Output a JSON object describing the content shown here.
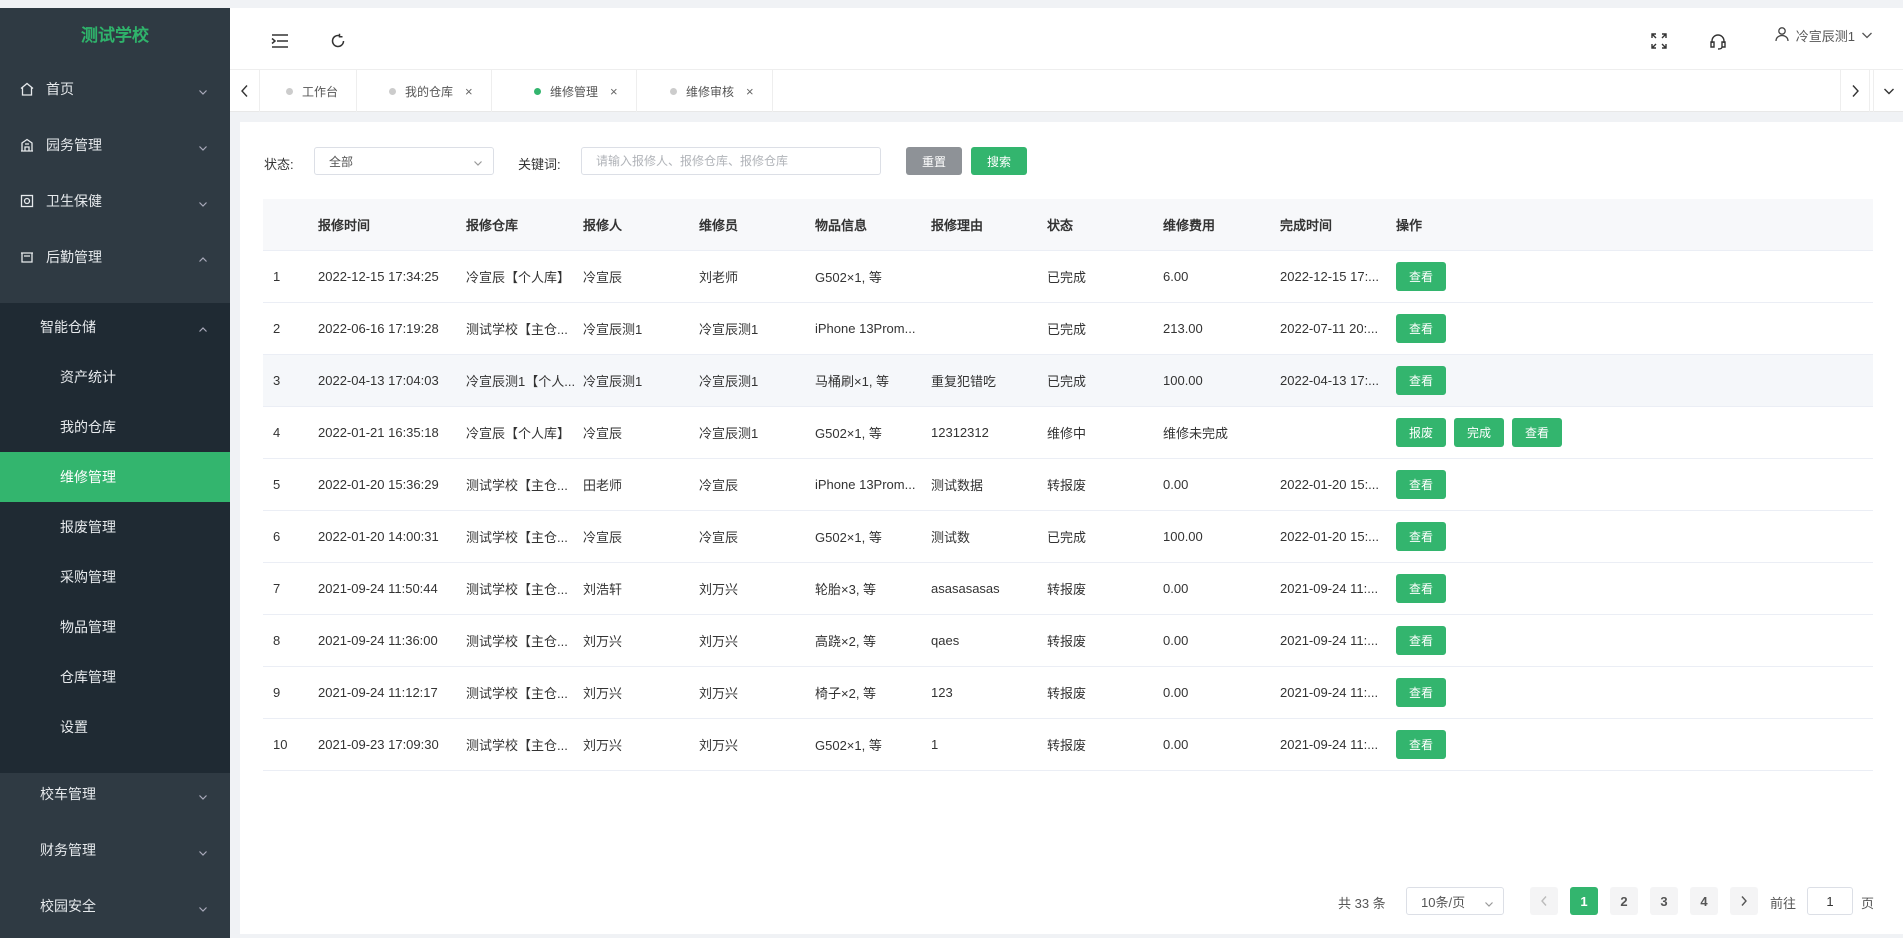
{
  "sidebar": {
    "logo": "测试学校",
    "top_items": [
      {
        "label": "首页",
        "icon": "home-icon"
      },
      {
        "label": "园务管理",
        "icon": "building-icon"
      },
      {
        "label": "卫生保健",
        "icon": "health-icon"
      },
      {
        "label": "后勤管理",
        "icon": "logistics-icon"
      }
    ],
    "group_label": "智能仓储",
    "sub_items": [
      "资产统计",
      "我的仓库",
      "维修管理",
      "报废管理",
      "采购管理",
      "物品管理",
      "仓库管理",
      "设置"
    ],
    "active_sub": "维修管理",
    "bottom_groups": [
      "校车管理",
      "财务管理",
      "校园安全"
    ]
  },
  "header": {
    "user_name": "冷宣辰测1"
  },
  "tabs": [
    {
      "label": "工作台",
      "closable": false
    },
    {
      "label": "我的仓库",
      "closable": true
    },
    {
      "label": "维修管理",
      "closable": true,
      "active": true
    },
    {
      "label": "维修审核",
      "closable": true
    }
  ],
  "filter": {
    "status_label": "状态:",
    "status_value": "全部",
    "keyword_label": "关键词:",
    "keyword_placeholder": "请输入报修人、报修仓库、报修仓库",
    "reset_label": "重置",
    "search_label": "搜索"
  },
  "table": {
    "columns": [
      "",
      "报修时间",
      "报修仓库",
      "报修人",
      "维修员",
      "物品信息",
      "报修理由",
      "状态",
      "维修费用",
      "完成时间",
      "操作"
    ],
    "rows": [
      [
        "1",
        "2022-12-15 17:34:25",
        "冷宣辰【个人库】",
        "冷宣辰",
        "刘老师",
        "G502×1, 等",
        "",
        "已完成",
        "6.00",
        "2022-12-15 17:...",
        [
          "查看"
        ]
      ],
      [
        "2",
        "2022-06-16 17:19:28",
        "测试学校【主仓...",
        "冷宣辰测1",
        "冷宣辰测1",
        "iPhone 13Prom...",
        "",
        "已完成",
        "213.00",
        "2022-07-11 20:...",
        [
          "查看"
        ]
      ],
      [
        "3",
        "2022-04-13 17:04:03",
        "冷宣辰测1【个人...",
        "冷宣辰测1",
        "冷宣辰测1",
        "马桶刷×1, 等",
        "重复犯错吃",
        "已完成",
        "100.00",
        "2022-04-13 17:...",
        [
          "查看"
        ]
      ],
      [
        "4",
        "2022-01-21 16:35:18",
        "冷宣辰【个人库】",
        "冷宣辰",
        "冷宣辰测1",
        "G502×1, 等",
        "12312312",
        "维修中",
        "维修未完成",
        "",
        [
          "报废",
          "完成",
          "查看"
        ]
      ],
      [
        "5",
        "2022-01-20 15:36:29",
        "测试学校【主仓...",
        "田老师",
        "冷宣辰",
        "iPhone 13Prom...",
        "测试数据",
        "转报废",
        "0.00",
        "2022-01-20 15:...",
        [
          "查看"
        ]
      ],
      [
        "6",
        "2022-01-20 14:00:31",
        "测试学校【主仓...",
        "冷宣辰",
        "冷宣辰",
        "G502×1, 等",
        "测试数",
        "已完成",
        "100.00",
        "2022-01-20 15:...",
        [
          "查看"
        ]
      ],
      [
        "7",
        "2021-09-24 11:50:44",
        "测试学校【主仓...",
        "刘浩轩",
        "刘万兴",
        "轮胎×3, 等",
        "asasasasas",
        "转报废",
        "0.00",
        "2021-09-24 11:...",
        [
          "查看"
        ]
      ],
      [
        "8",
        "2021-09-24 11:36:00",
        "测试学校【主仓...",
        "刘万兴",
        "刘万兴",
        "高跷×2, 等",
        "qaes",
        "转报废",
        "0.00",
        "2021-09-24 11:...",
        [
          "查看"
        ]
      ],
      [
        "9",
        "2021-09-24 11:12:17",
        "测试学校【主仓...",
        "刘万兴",
        "刘万兴",
        "椅子×2, 等",
        "123",
        "转报废",
        "0.00",
        "2021-09-24 11:...",
        [
          "查看"
        ]
      ],
      [
        "10",
        "2021-09-23 17:09:30",
        "测试学校【主仓...",
        "刘万兴",
        "刘万兴",
        "G502×1, 等",
        "1",
        "转报废",
        "0.00",
        "2021-09-24 11:...",
        [
          "查看"
        ]
      ]
    ]
  },
  "pagination": {
    "total_text": "共 33 条",
    "page_size": "10条/页",
    "pages": [
      "1",
      "2",
      "3",
      "4"
    ],
    "current_page": "1",
    "goto_label": "前往",
    "goto_value": "1",
    "page_unit": "页"
  },
  "colors": {
    "accent": "#33b56e",
    "sidebar_bg": "#2f3a43",
    "submenu_bg": "#1f2a33"
  }
}
